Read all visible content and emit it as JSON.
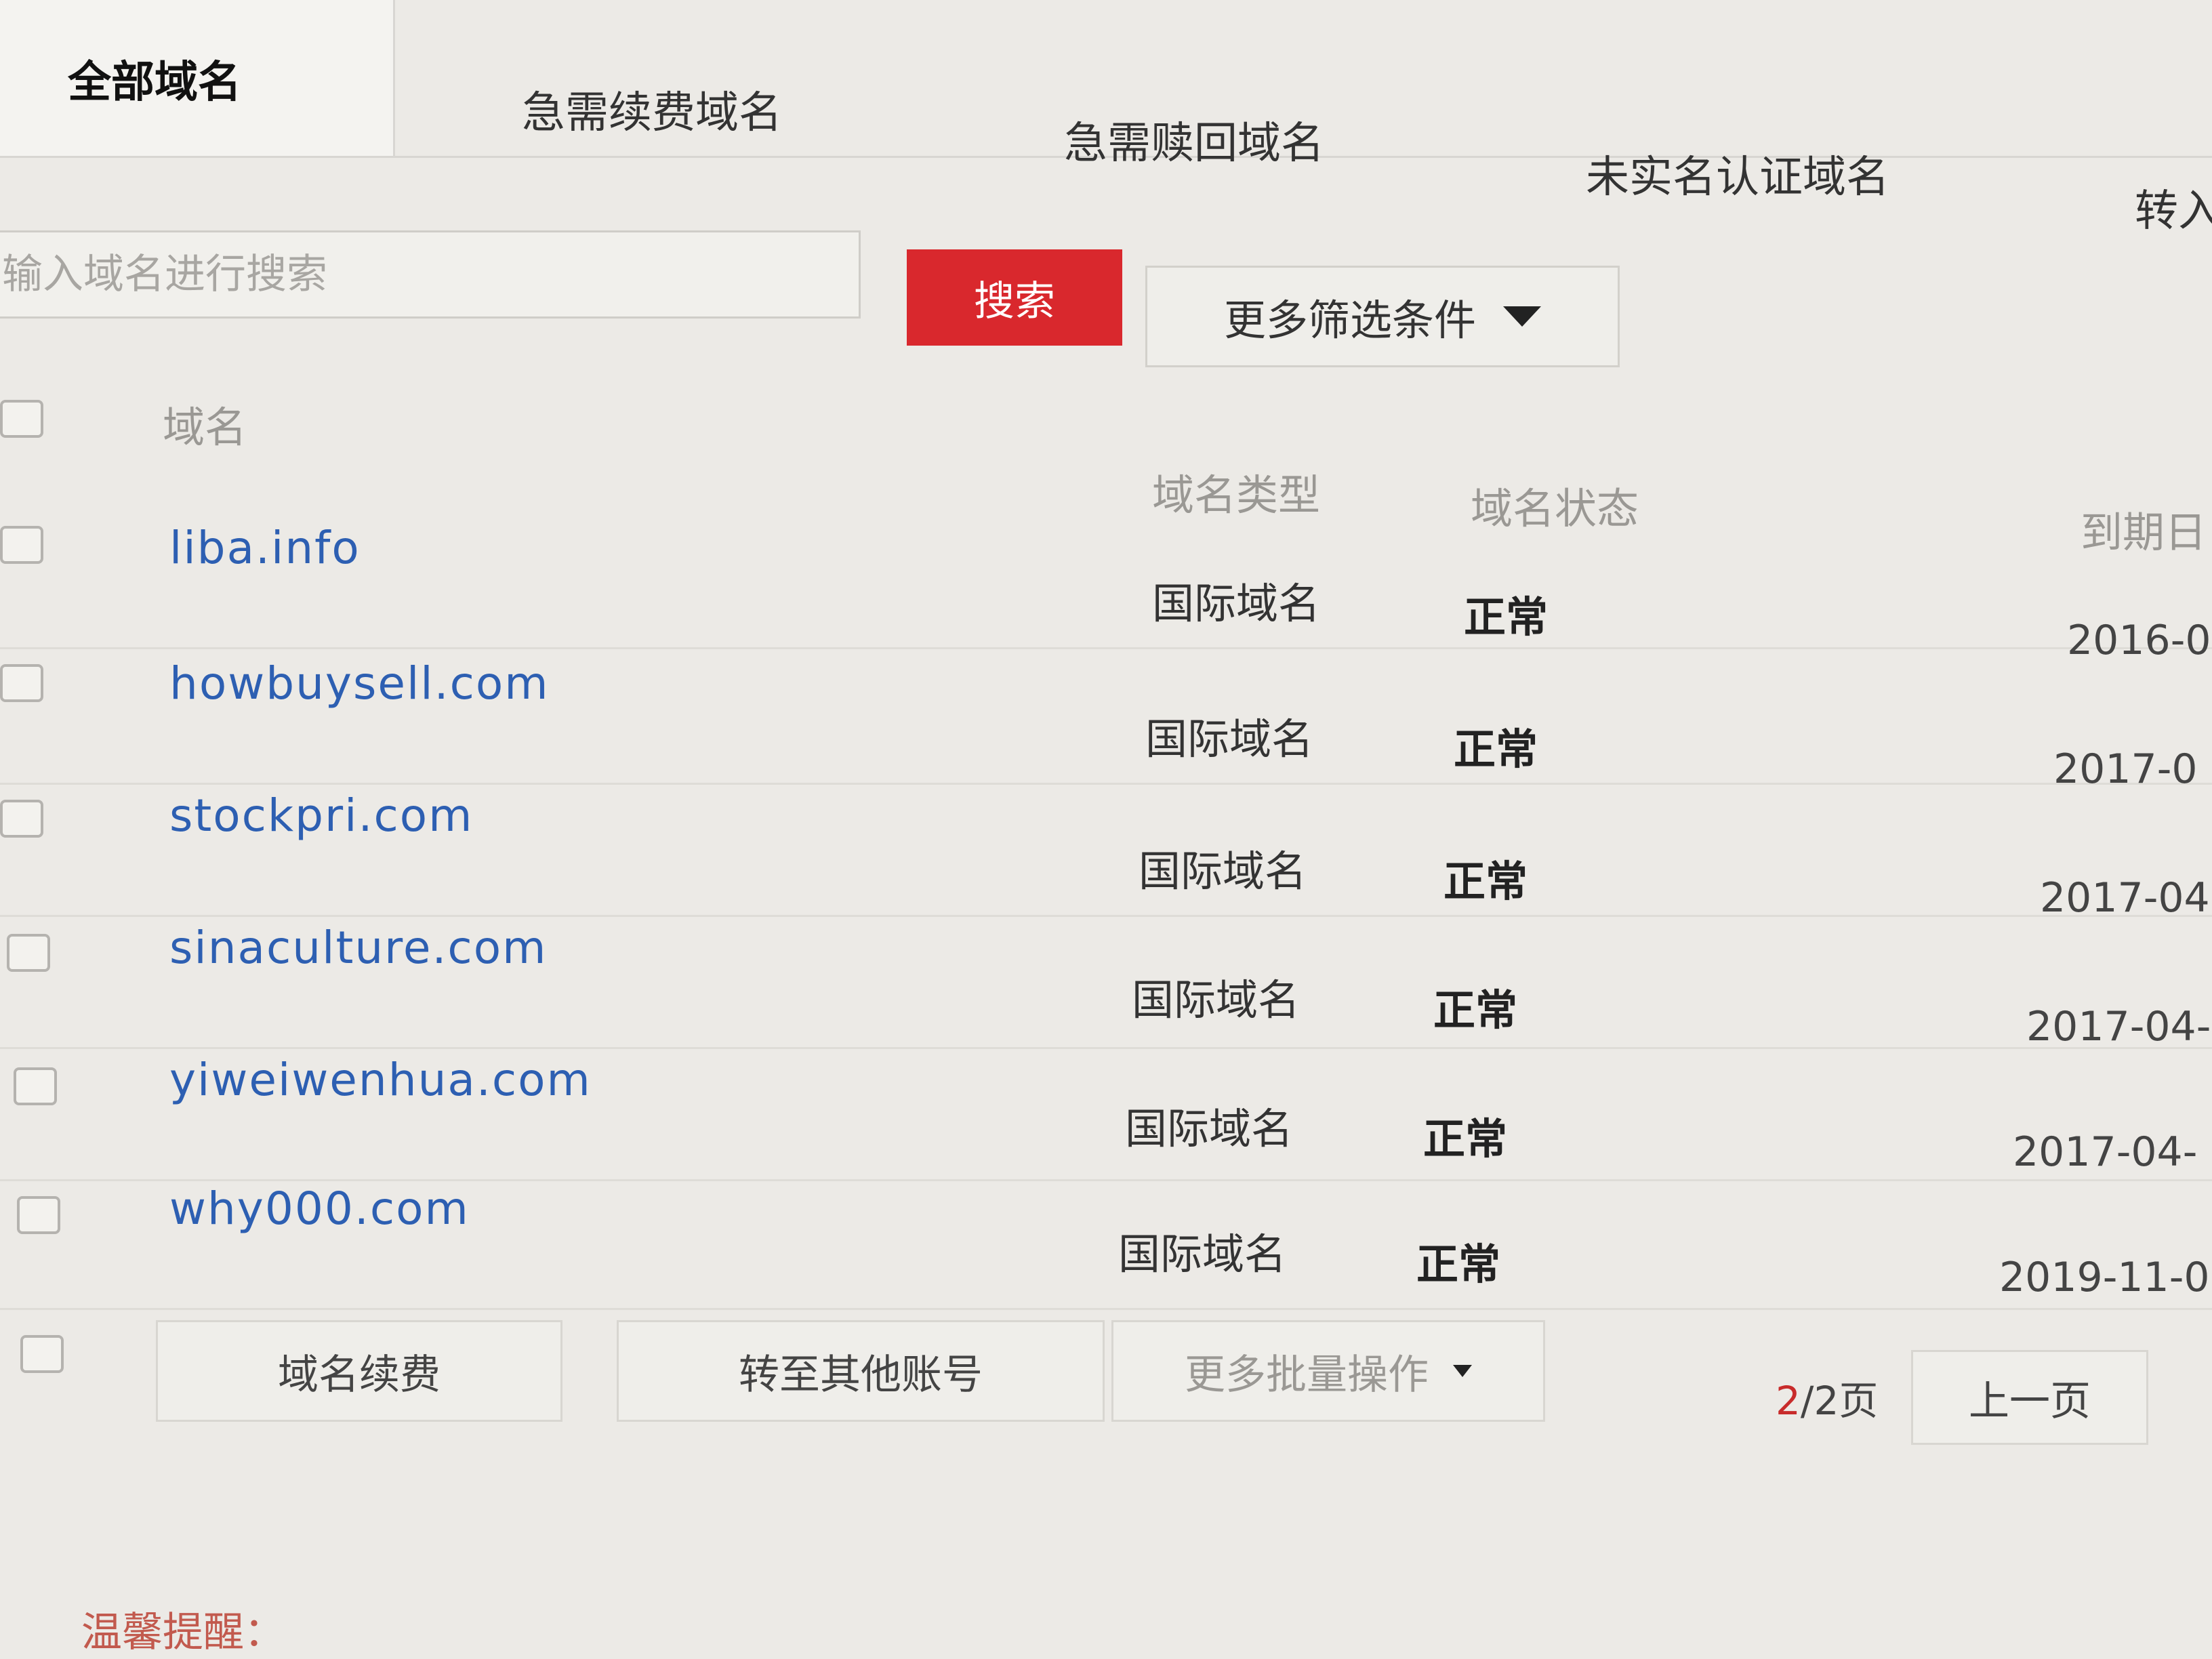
{
  "tabs": [
    {
      "label": "全部域名",
      "active": true
    },
    {
      "label": "急需续费域名",
      "active": false
    },
    {
      "label": "急需赎回域名",
      "active": false
    },
    {
      "label": "未实名认证域名",
      "active": false
    },
    {
      "label": "转入",
      "active": false
    }
  ],
  "search": {
    "placeholder": "输入域名进行搜索",
    "button_label": "搜索",
    "filter_label": "更多筛选条件",
    "filter_icon": "caret-down-icon"
  },
  "table": {
    "columns": {
      "domain": "域名",
      "type": "域名类型",
      "status": "域名状态",
      "expiry": "到期日"
    },
    "rows": [
      {
        "domain": "liba.info",
        "type": "国际域名",
        "status": "正常",
        "expiry": "2016-0"
      },
      {
        "domain": "howbuysell.com",
        "type": "国际域名",
        "status": "正常",
        "expiry": "2017-0"
      },
      {
        "domain": "stockpri.com",
        "type": "国际域名",
        "status": "正常",
        "expiry": "2017-04"
      },
      {
        "domain": "sinaculture.com",
        "type": "国际域名",
        "status": "正常",
        "expiry": "2017-04-"
      },
      {
        "domain": "yiweiwenhua.com",
        "type": "国际域名",
        "status": "正常",
        "expiry": "2017-04-"
      },
      {
        "domain": "why000.com",
        "type": "国际域名",
        "status": "正常",
        "expiry": "2019-11-0"
      }
    ]
  },
  "batch": {
    "renew_label": "域名续费",
    "transfer_label": "转至其他账号",
    "more_label": "更多批量操作",
    "more_icon": "caret-down-icon"
  },
  "pagination": {
    "current": "2",
    "total_text": "/2页",
    "prev_label": "上一页"
  },
  "tip": {
    "title": "温馨提醒："
  },
  "colors": {
    "accent_red": "#d9282d",
    "link_blue": "#2d5fb2",
    "background": "#eceae6"
  }
}
